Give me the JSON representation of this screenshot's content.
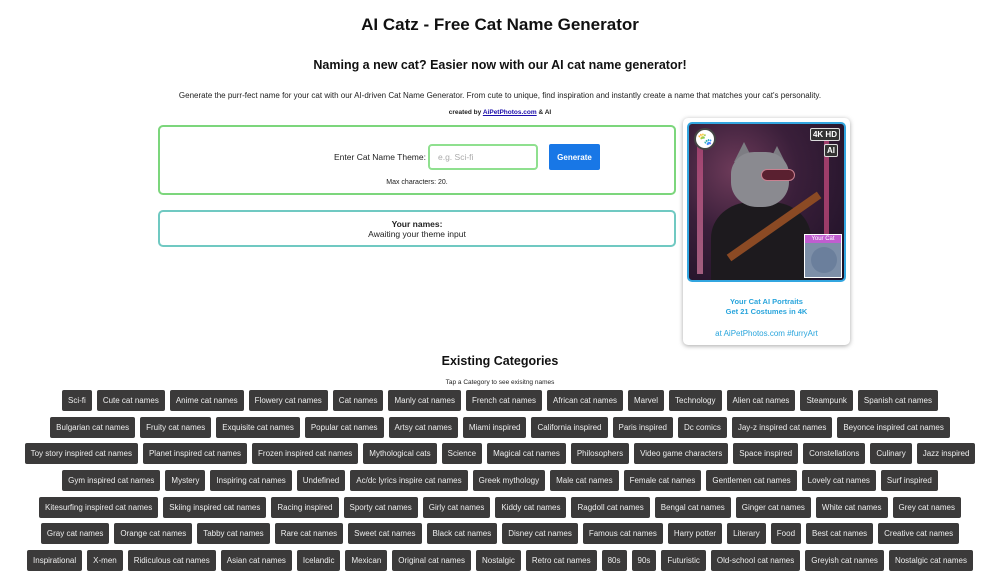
{
  "header": {
    "title": "AI Catz - Free Cat Name Generator",
    "subtitle": "Naming a new cat? Easier now with our AI cat name generator!",
    "description": "Generate the purr-fect name for your cat with our AI-driven Cat Name Generator. From cute to unique, find inspiration and instantly create a name that matches your cat's personality.",
    "credit_prefix": "created by",
    "credit_link": "AiPetPhotos.com",
    "credit_suffix": "& AI"
  },
  "generator": {
    "label": "Enter Cat Name Theme:",
    "input_value": "",
    "input_placeholder": "e.g. Sci-fi",
    "button_label": "Generate",
    "max_chars_note": "Max characters: 20."
  },
  "results": {
    "title": "Your names:",
    "status": "Awaiting your theme input"
  },
  "ad": {
    "logo_icon": "paw-icon",
    "badge_4k": "4K HD",
    "badge_ai": "AI",
    "your_cat_label": "Your Cat",
    "line1": "Your Cat AI Portraits",
    "line2": "Get 21 Costumes in 4K",
    "link_text": "at AiPetPhotos.com #furryArt"
  },
  "categories": {
    "heading": "Existing Categories",
    "hint": "Tap a Category to see exisitng names",
    "rows": [
      [
        "Sci-fi",
        "Cute cat names",
        "Anime cat names",
        "Flowery cat names",
        "Cat names",
        "Manly cat names",
        "French cat names",
        "African cat names",
        "Marvel",
        "Technology",
        "Alien cat names",
        "Steampunk",
        "Spanish cat names"
      ],
      [
        "Bulgarian cat names",
        "Fruity cat names",
        "Exquisite cat names",
        "Popular cat names",
        "Artsy cat names",
        "Miami inspired",
        "California inspired",
        "Paris inspired",
        "Dc comics",
        "Jay-z inspired cat names",
        "Beyonce inspired cat names"
      ],
      [
        "Toy story inspired cat names",
        "Planet inspired cat names",
        "Frozen inspired cat names",
        "Mythological cats",
        "Science",
        "Magical cat names",
        "Philosophers",
        "Video game characters",
        "Space inspired",
        "Constellations",
        "Culinary",
        "Jazz inspired"
      ],
      [
        "Gym inspired cat names",
        "Mystery",
        "Inspiring cat names",
        "Undefined",
        "Ac/dc lyrics inspire cat names",
        "Greek mythology",
        "Male cat names",
        "Female cat names",
        "Gentlemen cat names",
        "Lovely cat names",
        "Surf inspired"
      ],
      [
        "Kitesurfing inspired cat names",
        "Skiing inspired cat names",
        "Racing inspired",
        "Sporty cat names",
        "Girly cat names",
        "Kiddy cat names",
        "Ragdoll cat names",
        "Bengal cat names",
        "Ginger cat names",
        "White cat names",
        "Grey cat names"
      ],
      [
        "Gray cat names",
        "Orange cat names",
        "Tabby cat names",
        "Rare cat names",
        "Sweet cat names",
        "Black cat names",
        "Disney cat names",
        "Famous cat names",
        "Harry potter",
        "Literary",
        "Food",
        "Best cat names",
        "Creative cat names"
      ],
      [
        "Inspirational",
        "X-men",
        "Ridiculous cat names",
        "Asian cat names",
        "Icelandic",
        "Mexican",
        "Original cat names",
        "Nostalgic",
        "Retro cat names",
        "80s",
        "90s",
        "Futuristic",
        "Old-school cat names",
        "Greyish cat names",
        "Nostalgic cat names"
      ]
    ]
  }
}
